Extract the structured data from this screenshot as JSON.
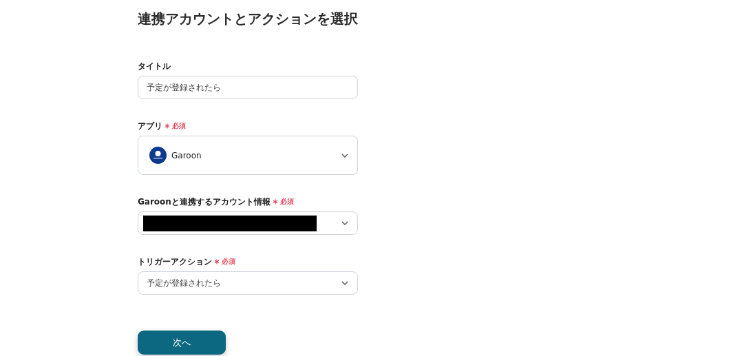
{
  "heading": "連携アカウントとアクションを選択",
  "fields": [
    {
      "kind": "text",
      "label": "タイトル",
      "value": "予定が登録されたら"
    },
    {
      "kind": "app-select",
      "label": "アプリ",
      "required_label": "必須",
      "value": "Garoon"
    },
    {
      "kind": "redacted-select",
      "label": "Garoonと連携するアカウント情報",
      "required_label": "必須"
    },
    {
      "kind": "select",
      "label": "トリガーアクション",
      "required_label": "必須",
      "value": "予定が登録されたら"
    }
  ],
  "next_button": "次へ"
}
